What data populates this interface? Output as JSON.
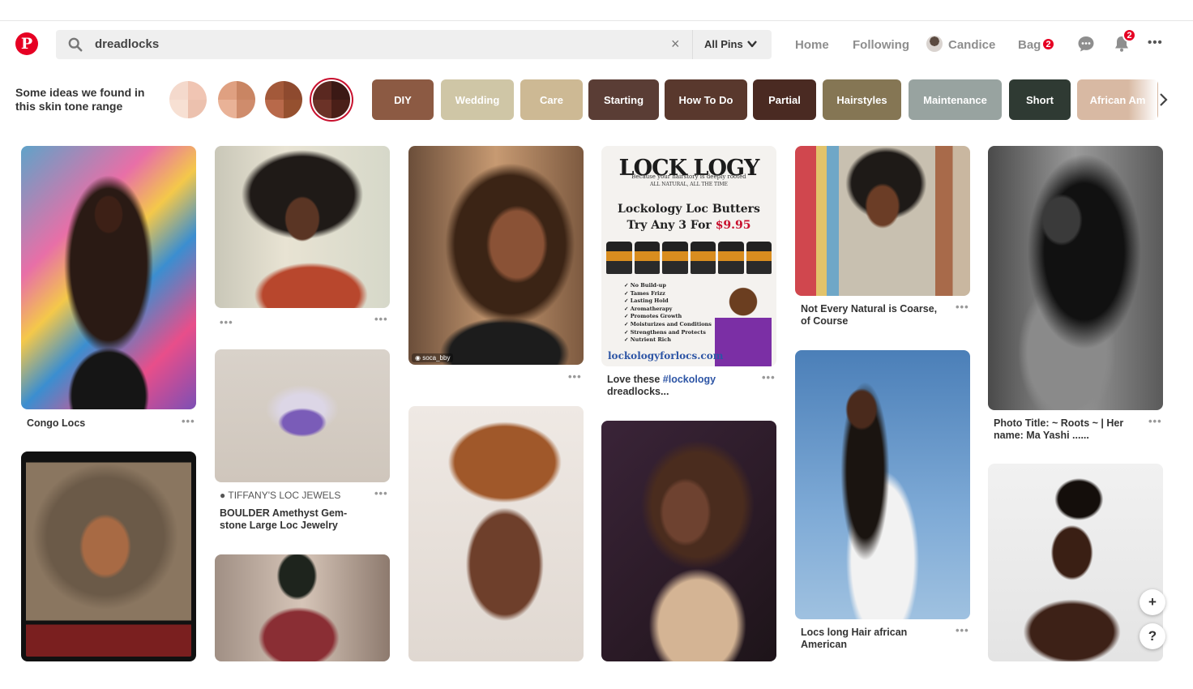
{
  "header": {
    "logo_letter": "P",
    "search_query": "dreadlocks",
    "clear_symbol": "×",
    "scope": "All Pins",
    "nav": {
      "home": "Home",
      "following": "Following",
      "user": "Candice",
      "bag": "Bag",
      "bag_count": "2",
      "notifications_count": "2"
    },
    "more_symbol": "•••"
  },
  "ideas": {
    "label": "Some ideas found in this skin tone range",
    "label_line1": "Some ideas we found in",
    "label_line2": "this skin tone range",
    "tones": [
      {
        "name": "light",
        "colors": [
          "#f4d9cc",
          "#f0c5b3",
          "#f7e0d3",
          "#ecc1ae"
        ]
      },
      {
        "name": "medium-light",
        "colors": [
          "#dfa081",
          "#c98563",
          "#e9b297",
          "#cf8c6c"
        ]
      },
      {
        "name": "medium-dark",
        "colors": [
          "#a3593a",
          "#8e4a2f",
          "#b8694a",
          "#95502f"
        ]
      },
      {
        "name": "dark",
        "colors": [
          "#5a2820",
          "#3b1915",
          "#6b3227",
          "#4a1f18"
        ],
        "selected": true
      }
    ],
    "chips": [
      {
        "label": "DIY",
        "color": "#8c5a43"
      },
      {
        "label": "Wedding",
        "color": "#cfc6a6"
      },
      {
        "label": "Care",
        "color": "#cdb994"
      },
      {
        "label": "Starting",
        "color": "#5a3d35"
      },
      {
        "label": "How To Do",
        "color": "#59382d"
      },
      {
        "label": "Partial",
        "color": "#4a2a22"
      },
      {
        "label": "Hairstyles",
        "color": "#857654"
      },
      {
        "label": "Maintenance",
        "color": "#98a3a0"
      },
      {
        "label": "Short",
        "color": "#2f3a33"
      },
      {
        "label": "African Am",
        "color": "#d8b9a3"
      }
    ]
  },
  "pins": {
    "congo": {
      "title": "Congo Locs"
    },
    "amethyst": {
      "source": "TIFFANY'S LOC JEWELS",
      "title_line1": "BOULDER Amethyst Gem-",
      "title_line2": "stone Large Loc Jewelry"
    },
    "redlips": {
      "credit": "soca_bby"
    },
    "lockology": {
      "brand": "LOCK LOGY",
      "tagline": "Because your hairstory is deeply rooted",
      "tagline2": "ALL NATURAL, ALL THE TIME",
      "headline1": "Lockology Loc Butters",
      "headline2_prefix": "Try Any 3 For ",
      "price": "$9.95",
      "features": [
        "No Build-up",
        "Tames Frizz",
        "Lasting Hold",
        "Aromatherapy",
        "Promotes Growth",
        "Moisturizes and Conditions",
        "Strengthens and Protects",
        "Nutrient Rich"
      ],
      "url": "lockologyforlocs.com",
      "title_prefix": "Love these ",
      "title_tag": "#lockology",
      "title_line2": "dreadlocks..."
    },
    "coarse": {
      "title_line1": "Not Every Natural is Coarse,",
      "title_line2": "of Course"
    },
    "longhair": {
      "title_line1": "Locs long Hair african",
      "title_line2": "American"
    },
    "roots": {
      "title_line1": "Photo Title: ~ Roots ~   |   Her",
      "title_line2": "name: Ma Yashi ......"
    },
    "more_symbol": "•••"
  },
  "fab": {
    "add": "+",
    "help": "?"
  }
}
